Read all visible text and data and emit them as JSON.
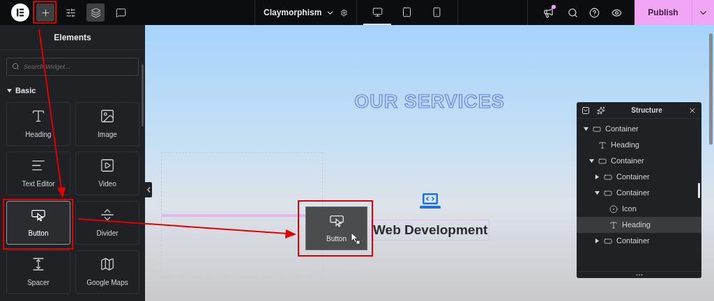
{
  "topbar": {
    "tools": [
      {
        "kind": "add",
        "selected": true
      },
      {
        "kind": "settings",
        "selected": false
      },
      {
        "kind": "structure",
        "selected": true
      },
      {
        "kind": "notes",
        "selected": false
      }
    ],
    "page_title": "Claymorphism",
    "devices": [
      {
        "kind": "desktop",
        "selected": true
      },
      {
        "kind": "tablet",
        "selected": false
      },
      {
        "kind": "mobile",
        "selected": false
      }
    ],
    "notification": true,
    "publish": "Publish"
  },
  "elements_panel": {
    "title": "Elements",
    "search": {
      "placeholder": "Search Widget..."
    },
    "category": {
      "label": "Basic",
      "expanded": true
    },
    "widgets": [
      {
        "label": "Heading",
        "kind": "heading",
        "selected": false
      },
      {
        "label": "Image",
        "kind": "image",
        "selected": false
      },
      {
        "label": "Text Editor",
        "kind": "text-editor",
        "selected": false
      },
      {
        "label": "Video",
        "kind": "video",
        "selected": false
      },
      {
        "label": "Button",
        "kind": "button",
        "selected": true
      },
      {
        "label": "Divider",
        "kind": "divider",
        "selected": false
      },
      {
        "label": "Spacer",
        "kind": "spacer",
        "selected": false
      },
      {
        "label": "Google Maps",
        "kind": "map",
        "selected": false
      }
    ]
  },
  "canvas": {
    "heading": "OUR SERVICES",
    "service": {
      "title": "Web Development"
    },
    "drag_ghost": {
      "label": "Button"
    }
  },
  "structure": {
    "title": "Structure",
    "tree": [
      {
        "label": "Container",
        "kind": "container",
        "expanded": true,
        "selected": false,
        "children": [
          {
            "label": "Heading",
            "kind": "heading",
            "selected": false
          },
          {
            "label": "Container",
            "kind": "container",
            "expanded": true,
            "selected": false,
            "children": [
              {
                "label": "Container",
                "kind": "container",
                "expanded": false,
                "selected": false
              },
              {
                "label": "Container",
                "kind": "container",
                "expanded": true,
                "selected": false,
                "children": [
                  {
                    "label": "Icon",
                    "kind": "icon",
                    "selected": false
                  },
                  {
                    "label": "Heading",
                    "kind": "heading",
                    "selected": true
                  }
                ]
              },
              {
                "label": "Container",
                "kind": "container",
                "expanded": false,
                "selected": false
              }
            ]
          }
        ]
      }
    ]
  }
}
